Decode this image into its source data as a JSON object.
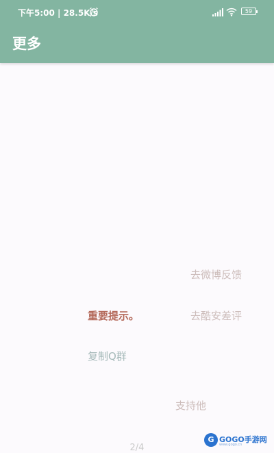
{
  "status_bar": {
    "time_network": "下午5:00 | 28.5K/s",
    "battery_level": "59"
  },
  "app_bar": {
    "title": "更多"
  },
  "options": {
    "weibo_feedback": "去微博反馈",
    "coolapk_review": "去酷安差评",
    "important_notice": "重要提示。",
    "copy_qq_group": "复制Q群",
    "support": "支持他"
  },
  "pager": {
    "indicator": "2/4"
  },
  "watermark": {
    "logo_letter": "G",
    "brand": "GOGO手游网",
    "url": "www.gogo.cn"
  },
  "colors": {
    "app_bar": "#83b5a1",
    "background": "#fcfafd",
    "notice_text": "#b4695a",
    "faded_text": "#cdbdbb",
    "qq_text": "#a5b9b9"
  }
}
